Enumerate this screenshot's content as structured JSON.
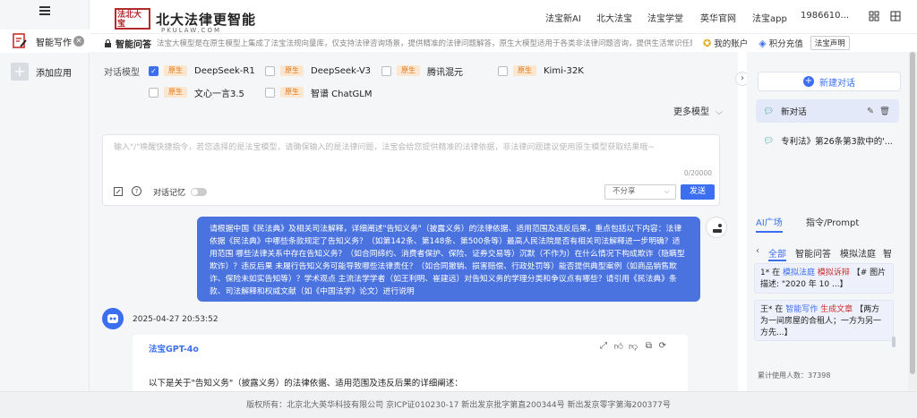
{
  "sidebar": {
    "items": [
      {
        "label": "智能写作",
        "icon": "document-edit-icon"
      },
      {
        "label": "添加应用",
        "icon": "plus-icon"
      }
    ]
  },
  "header": {
    "logo_box": "法北大宝",
    "logo_title": "北大法律更智能",
    "logo_sub": "PKULAW.COM",
    "nav": [
      "法宝新AI",
      "北大法宝",
      "法宝学堂",
      "英华官网",
      "法宝app",
      "1986610..."
    ]
  },
  "infobar": {
    "section": "智能问答",
    "desc": "法宝大模型是在原生模型上集成了法宝法规向量库，仅支持法律咨询场景，提供精准的法律问题解答，原生大模型适用于各类非法律问题咨询，提供生活常识任是专业知识的解答",
    "account": "我的账户",
    "points": "积分充值",
    "statement": "法宝声明"
  },
  "models": {
    "label": "对话模型",
    "items": [
      {
        "tag": "原生",
        "name": "DeepSeek-R1",
        "checked": true
      },
      {
        "tag": "原生",
        "name": "DeepSeek-V3",
        "checked": false
      },
      {
        "tag": "原生",
        "name": "腾讯混元",
        "checked": false
      },
      {
        "tag": "原生",
        "name": "Kimi-32K",
        "checked": false
      },
      {
        "tag": "原生",
        "name": "文心一言3.5",
        "checked": false
      },
      {
        "tag": "原生",
        "name": "智谱 ChatGLM",
        "checked": false
      }
    ],
    "more": "更多模型"
  },
  "input": {
    "placeholder": "输入\"/\"唤醒快捷指令，若您选择的是法宝模型，请确保输入的是法律问题，法宝会给您提供精准的法律依据，非法律问题建议使用原生模型获取结果哦~",
    "counter": "0/20000",
    "memory_label": "对话记忆",
    "share_select": "不分享",
    "send": "发送"
  },
  "chat": {
    "user_message": "请根据中国《民法典》及相关司法解释，详细阐述\"告知义务\"（披露义务）的法律依据、适用范围及违反后果，重点包括以下内容：法律依据《民法典》中哪些条款规定了告知义务？（如第142条、第148条、第500条等）最高人民法院是否有相关司法解释进一步明确？适用范围 哪些法律关系中存在告知义务？（如合同缔约、消费者保护、保险、证券交易等）沉默（不作为）在什么情况下构成欺诈（隐瞒型欺诈）？违反后果 未履行告知义务可能导致哪些法律责任？（如合同撤销、损害赔偿、行政处罚等）能否提供典型案例（如商品销售欺诈、保险未如实告知等）？学术观点 主流法学学者（如王利明、崔建远）对告知义务的学理分类和争议点有哪些？请引用《民法典》条款、司法解释和权威文献（如《中国法学》论文）进行说明",
    "timestamp": "2025-04-27 20:53:52",
    "answer_model": "法宝GPT-4o",
    "answer_text": "以下是关于\"告知义务\"（披露义务）的法律依据、适用范围及违反后果的详细阐述："
  },
  "right": {
    "new_chat": "新建对话",
    "conversations": [
      "新对话",
      "专利法》第26条第3款中的'..."
    ],
    "tabs": [
      "AI广场",
      "指令/Prompt"
    ],
    "filters": [
      "全部",
      "智能问答",
      "模拟法庭",
      "智"
    ],
    "cards": [
      {
        "user": "1*",
        "mid": "在",
        "cat": "模拟法庭",
        "sub": "模拟诉辩",
        "text": "【# 图片描述: \"2020 年 10 ...】"
      },
      {
        "user": "王*",
        "mid": "在",
        "cat": "智能写作",
        "sub": "生成文章",
        "text": "【两方为一间房屋的合租人；一方为另一方先...】"
      }
    ],
    "usage": "累计使用人数：37398"
  },
  "footer": "版权所有：北京北大英华科技有限公司 京ICP证010230-17 新出发京批字第直200344号 新出发京零字第海200377号"
}
